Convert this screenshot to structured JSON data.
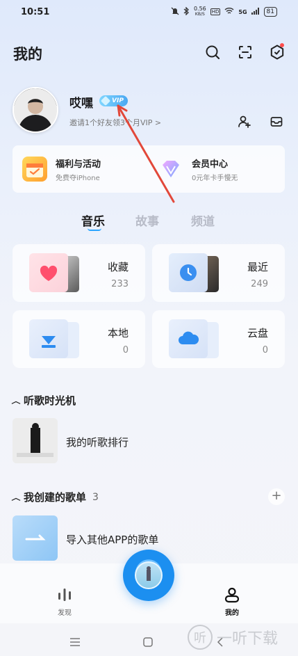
{
  "status_bar": {
    "time": "10:51",
    "net_speed": "0.56",
    "net_unit": "KB/S",
    "battery": "81",
    "signal": "5G"
  },
  "header": {
    "title": "我的"
  },
  "profile": {
    "name": "哎嘿",
    "vip_label": "VIP",
    "invite_text": "邀请1个好友领3个月VIP >"
  },
  "benefits": [
    {
      "title": "福利与活动",
      "subtitle": "免费夺iPhone"
    },
    {
      "title": "会员中心",
      "subtitle": "0元年卡手慢无"
    }
  ],
  "tabs": [
    {
      "label": "音乐",
      "active": true
    },
    {
      "label": "故事",
      "active": false
    },
    {
      "label": "频道",
      "active": false
    }
  ],
  "library": [
    {
      "label": "收藏",
      "count": "233",
      "icon": "heart-icon"
    },
    {
      "label": "最近",
      "count": "249",
      "icon": "clock-icon"
    },
    {
      "label": "本地",
      "count": "0",
      "icon": "download-icon"
    },
    {
      "label": "云盘",
      "count": "0",
      "icon": "cloud-icon"
    }
  ],
  "time_machine": {
    "title": "听歌时光机",
    "item": "我的听歌排行"
  },
  "my_playlists": {
    "title": "我创建的歌单",
    "count": "3",
    "item": "导入其他APP的歌单"
  },
  "bottom_nav": [
    {
      "label": "发现",
      "icon": "equalizer-icon",
      "active": false
    },
    {
      "label": "我的",
      "icon": "user-icon",
      "active": true
    }
  ],
  "watermark": {
    "logo": "听",
    "text": "一听下载"
  },
  "colors": {
    "accent": "#2aa5ff",
    "vip": "#4aa8f2",
    "heart": "#ff4f6d",
    "arrow": "#e2483a"
  }
}
